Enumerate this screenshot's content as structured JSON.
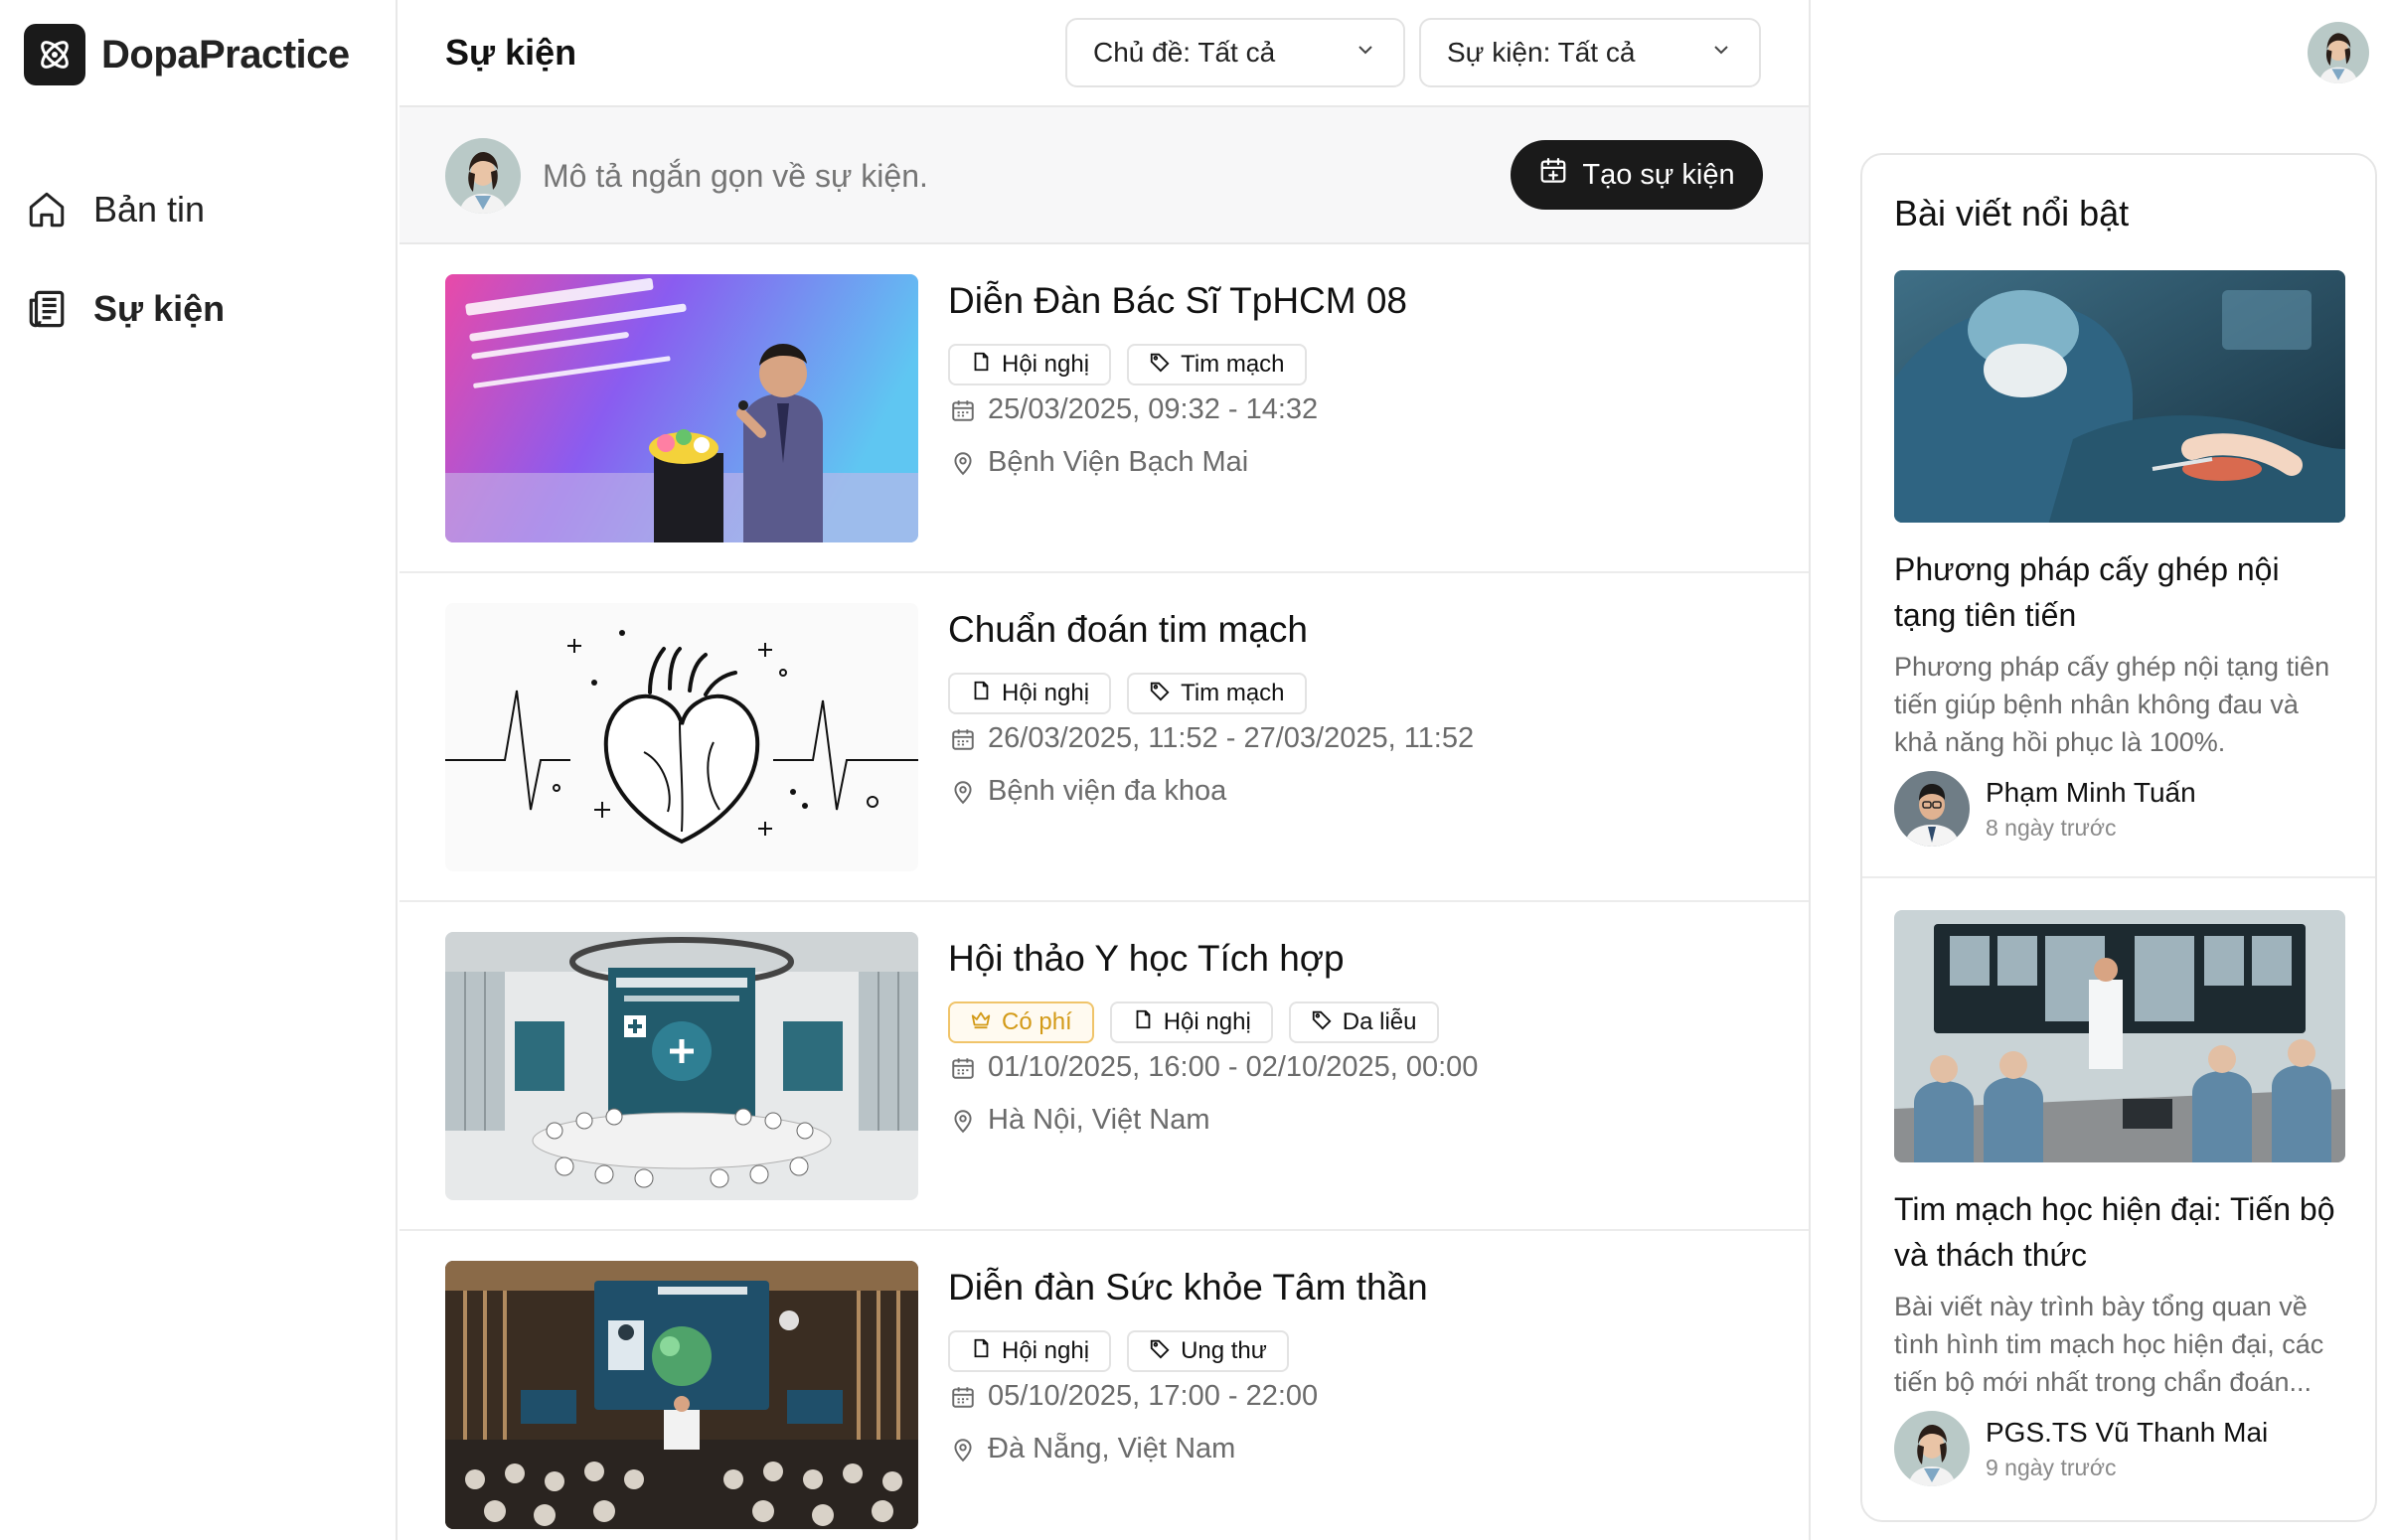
{
  "brand": {
    "name": "DopaPractice"
  },
  "sidebar": {
    "items": [
      {
        "label": "Bản tin",
        "icon": "home-icon",
        "active": false
      },
      {
        "label": "Sự kiện",
        "icon": "newspaper-icon",
        "active": true
      }
    ]
  },
  "header": {
    "title": "Sự kiện",
    "filter_topic": "Chủ đề: Tất cả",
    "filter_event": "Sự kiện: Tất cả"
  },
  "composer": {
    "placeholder": "Mô tả ngắn gọn về sự kiện.",
    "create_label": "Tạo sự kiện"
  },
  "events": [
    {
      "title": "Diễn Đàn Bác Sĩ TpHCM 08",
      "tags": [
        "Hội nghị",
        "Tim mạch"
      ],
      "time": "25/03/2025, 09:32 - 14:32",
      "place": "Bệnh Viện Bạch Mai"
    },
    {
      "title": "Chuẩn đoán tim mạch",
      "tags": [
        "Hội nghị",
        "Tim mạch"
      ],
      "time": "26/03/2025, 11:52 - 27/03/2025, 11:52",
      "place": "Bệnh viện đa khoa"
    },
    {
      "title": "Hội thảo Y học Tích hợp",
      "paid_label": "Có phí",
      "tags": [
        "Hội nghị",
        "Da liễu"
      ],
      "time": "01/10/2025, 16:00 - 02/10/2025, 00:00",
      "place": "Hà Nội, Việt Nam"
    },
    {
      "title": "Diễn đàn Sức khỏe Tâm thần",
      "tags": [
        "Hội nghị",
        "Ung thư"
      ],
      "time": "05/10/2025, 17:00 - 22:00",
      "place": "Đà Nẵng, Việt Nam"
    }
  ],
  "featured": {
    "title": "Bài viết nổi bật",
    "articles": [
      {
        "title": "Phương pháp cấy ghép nội tạng tiên tiến",
        "desc": "Phương pháp cấy ghép nội tạng tiên tiến giúp bệnh nhân không đau và khả năng hồi phục là 100%.",
        "author": "Phạm Minh Tuấn",
        "time": "8 ngày trước"
      },
      {
        "title": "Tim mạch học hiện đại: Tiến bộ và thách thức",
        "desc": "Bài viết này trình bày tổng quan về tình hình tim mạch học hiện đại, các tiến bộ mới nhất trong chẩn đoán...",
        "author": "PGS.TS Vũ Thanh Mai",
        "time": "9 ngày trước"
      }
    ]
  },
  "colors": {
    "accent": "#1a1a1a",
    "paid": "#d39a17",
    "muted": "#6b6b6b"
  }
}
